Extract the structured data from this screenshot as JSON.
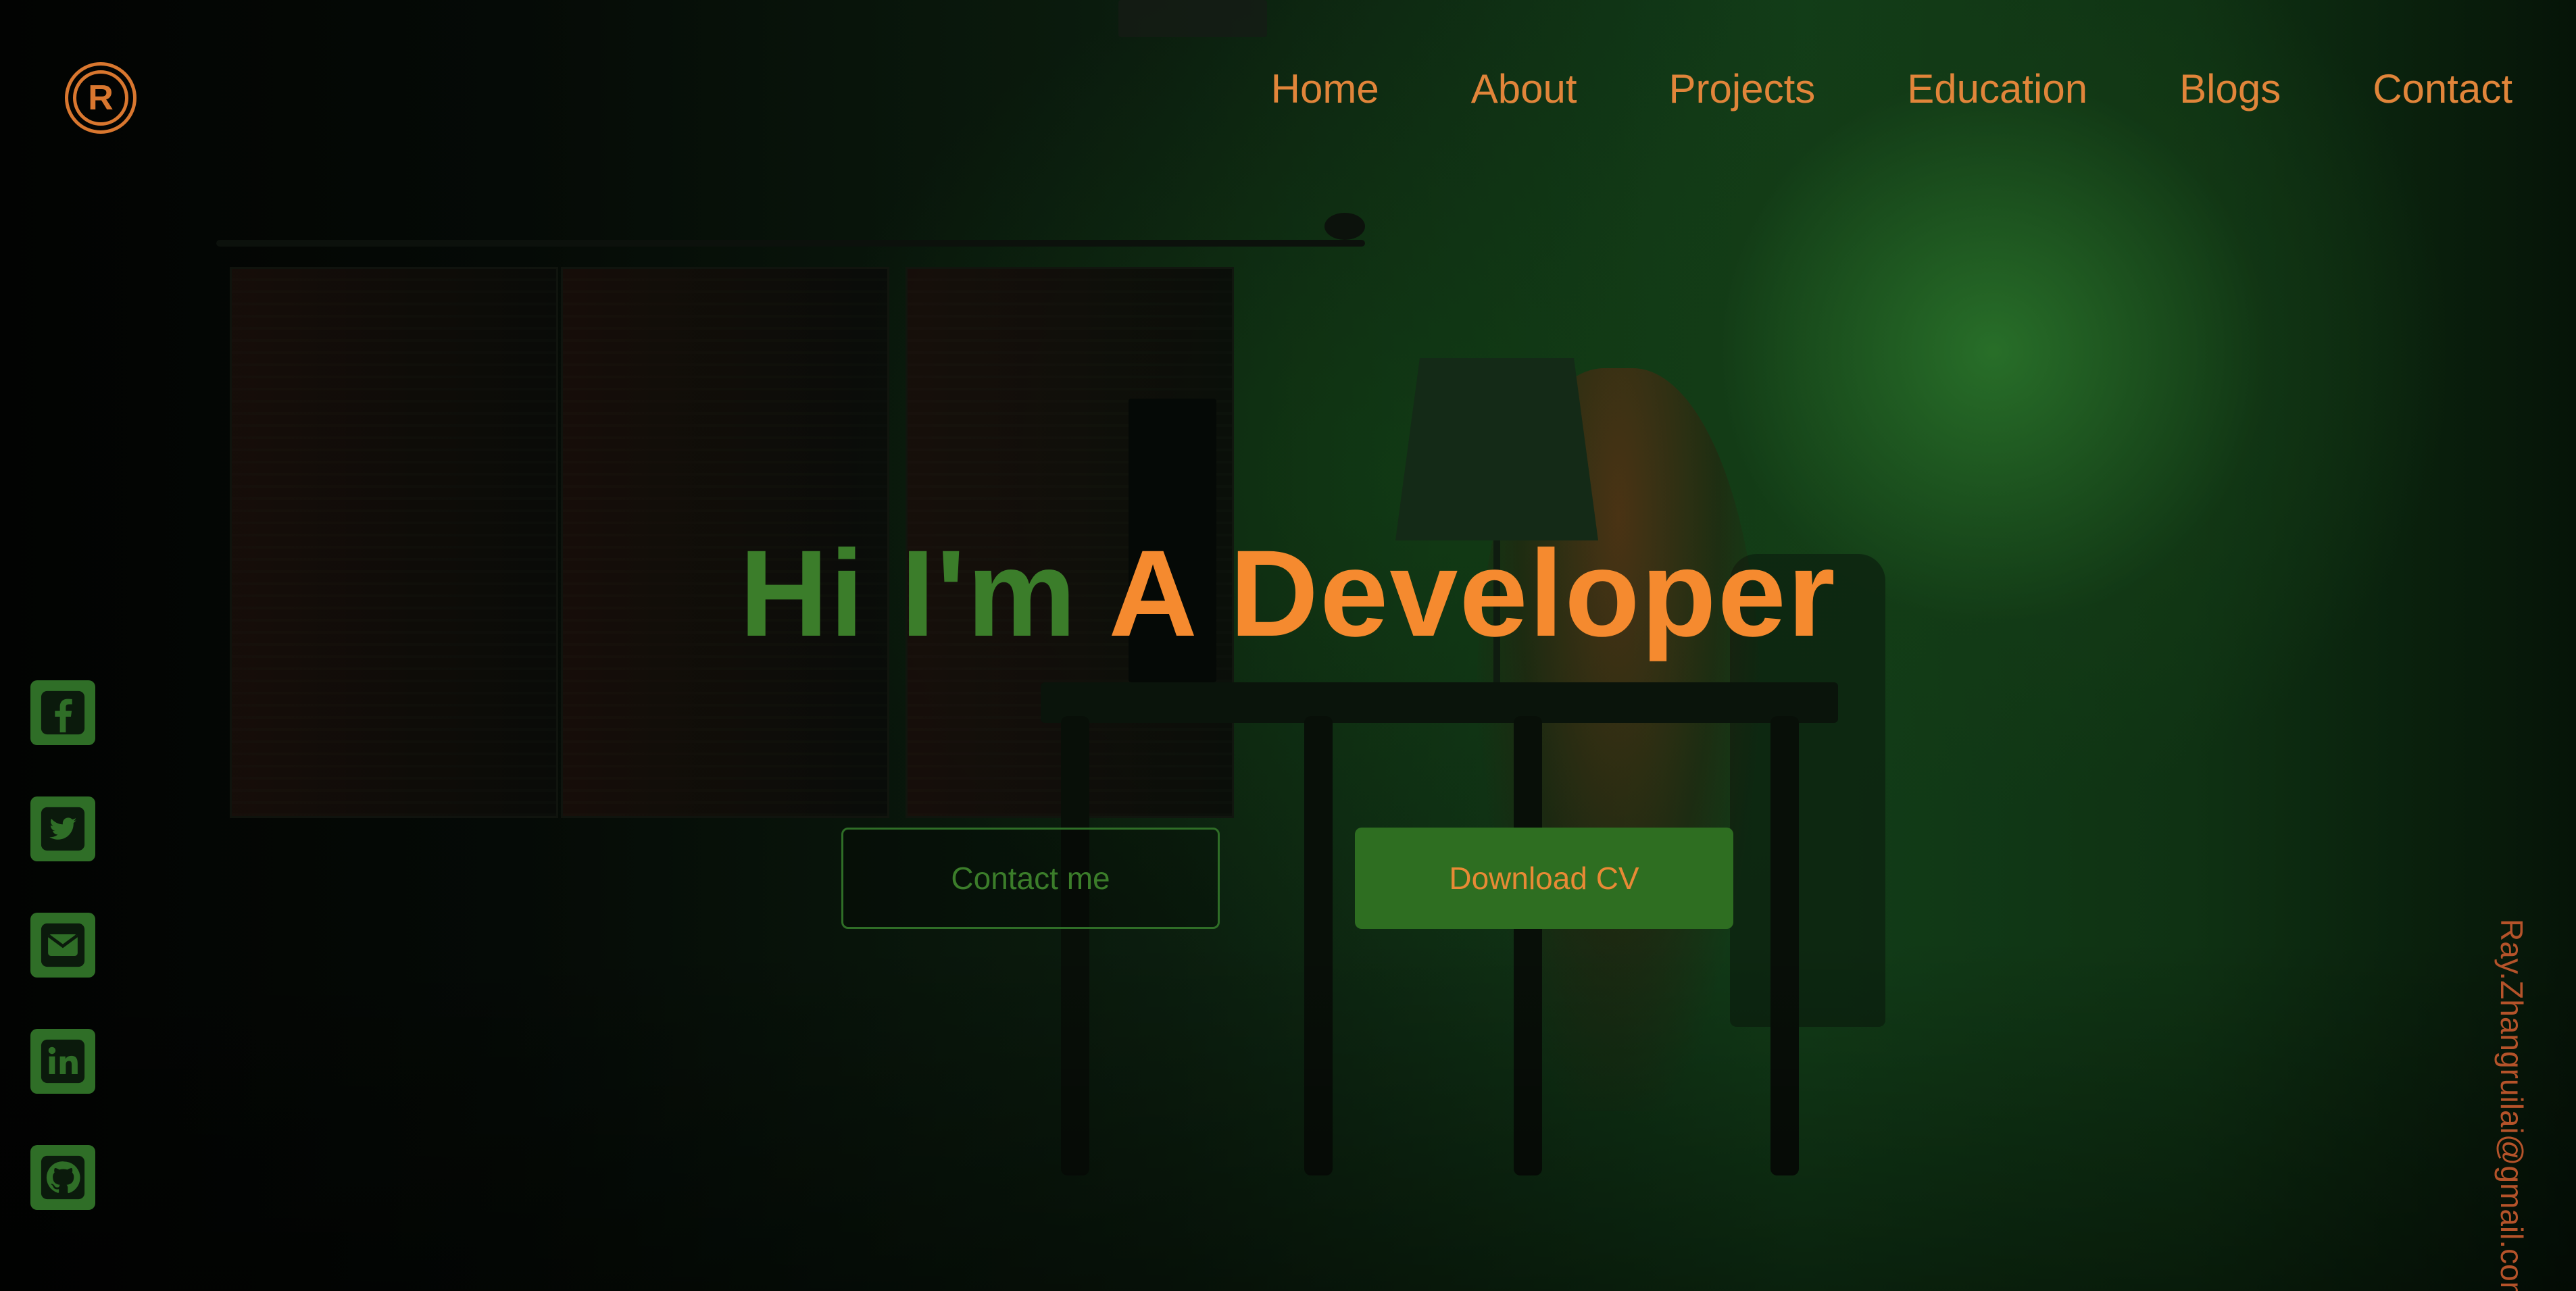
{
  "brand": {
    "logo_letter": "R"
  },
  "nav": {
    "items": [
      "Home",
      "About",
      "Projects",
      "Education",
      "Blogs",
      "Contact"
    ]
  },
  "hero": {
    "title_part1": "Hi I'm",
    "title_part2": "A Developer",
    "contact_button": "Contact me",
    "cv_button": "Download CV"
  },
  "social": [
    {
      "icon": "facebook-icon"
    },
    {
      "icon": "twitter-icon"
    },
    {
      "icon": "email-icon"
    },
    {
      "icon": "linkedin-icon"
    },
    {
      "icon": "github-icon"
    }
  ],
  "email": "Ray.Zhangruilai@gmail.com",
  "colors": {
    "accent_orange": "#f58a2f",
    "accent_green": "#3b7d2a",
    "button_green": "#2e6e21"
  }
}
